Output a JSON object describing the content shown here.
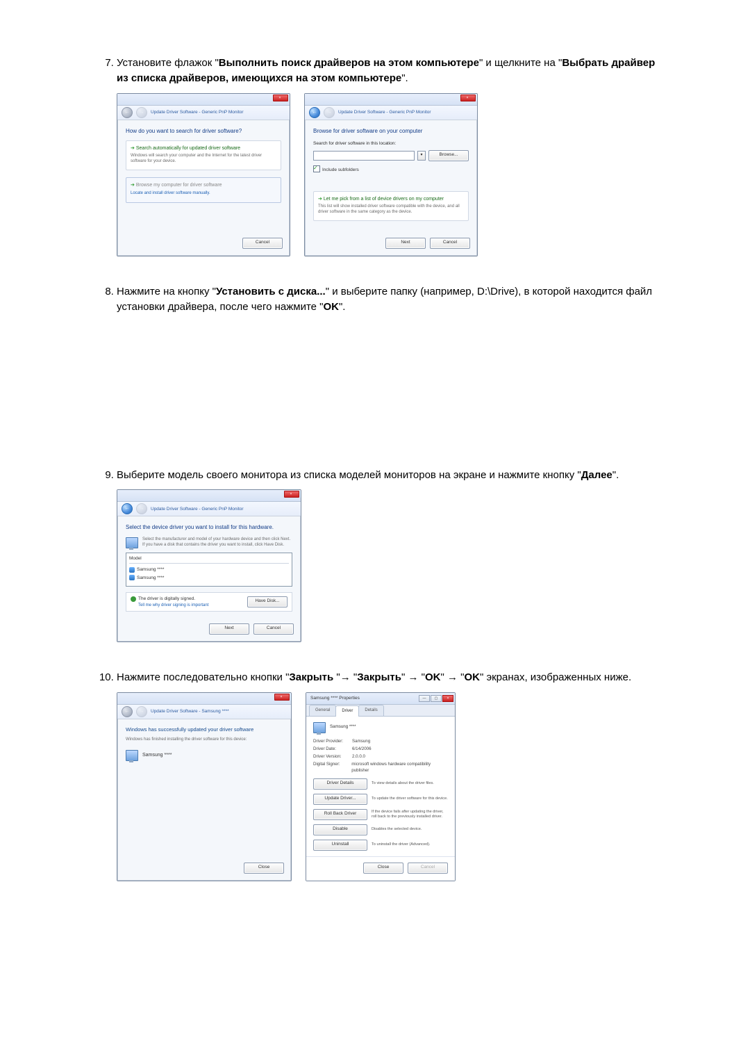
{
  "steps": {
    "s7": {
      "text_pre": "Установите флажок \"",
      "bold1": "Выполнить поиск драйверов на этом компьютере",
      "text_mid": "\" и щелкните на \"",
      "bold2": "Выбрать драйвер из списка драйверов, имеющихся на этом компьютере",
      "text_post": "\".",
      "dlg1": {
        "crumb": "Update Driver Software - Generic PnP Monitor",
        "heading": "How do you want to search for driver software?",
        "opt1_title": "Search automatically for updated driver software",
        "opt1_sub": "Windows will search your computer and the Internet for the latest driver software for your device.",
        "opt2_title": "Browse my computer for driver software",
        "opt2_sub": "Locate and install driver software manually.",
        "cancel": "Cancel"
      },
      "dlg2": {
        "crumb": "Update Driver Software - Generic PnP Monitor",
        "heading": "Browse for driver software on your computer",
        "label": "Search for driver software in this location:",
        "path_value": "",
        "browse": "Browse...",
        "include_sub": "Include subfolders",
        "opt_title": "Let me pick from a list of device drivers on my computer",
        "opt_sub": "This list will show installed driver software compatible with the device, and all driver software in the same category as the device.",
        "next": "Next",
        "cancel": "Cancel"
      }
    },
    "s8": {
      "t1": "Нажмите на кнопку \"",
      "b1": "Установить с диска...",
      "t2": "\" и выберите папку (например, D:\\Drive), в которой находится файл установки драйвера, после чего нажмите \"",
      "b2": "OK",
      "t3": "\"."
    },
    "s9": {
      "t1": "Выберите модель своего монитора из списка моделей мониторов на экране и нажмите кнопку \"",
      "b1": "Далее",
      "t2": "\".",
      "dlg": {
        "crumb": "Update Driver Software - Generic PnP Monitor",
        "heading": "Select the device driver you want to install for this hardware.",
        "sub": "Select the manufacturer and model of your hardware device and then click Next. If you have a disk that contains the driver you want to install, click Have Disk.",
        "model_col": "Model",
        "model1": "Samsung ****",
        "model2": "Samsung ****",
        "signed": "The driver is digitally signed.",
        "signed_link": "Tell me why driver signing is important",
        "have_disk": "Have Disk...",
        "next": "Next",
        "cancel": "Cancel"
      }
    },
    "s10": {
      "t1": "Нажмите последовательно кнопки \"",
      "b1": "Закрыть",
      "arrow": " \"→ \"",
      "b2": "Закрыть",
      "t2": "\" → \"",
      "b3": "OK",
      "t3": "\" → \"",
      "b4": "OK",
      "t4": "\" экранах, изображенных ниже.",
      "dlgA": {
        "crumb": "Update Driver Software - Samsung ****",
        "heading": "Windows has successfully updated your driver software",
        "sub": "Windows has finished installing the driver software for this device:",
        "device": "Samsung ****",
        "close": "Close"
      },
      "dlgB": {
        "title": "Samsung **** Properties",
        "tab_general": "General",
        "tab_driver": "Driver",
        "tab_details": "Details",
        "device": "Samsung ****",
        "k_provider": "Driver Provider:",
        "v_provider": "Samsung",
        "k_date": "Driver Date:",
        "v_date": "6/14/2006",
        "k_version": "Driver Version:",
        "v_version": "2.0.0.0",
        "k_signer": "Digital Signer:",
        "v_signer": "microsoft windows hardware compatibility publisher",
        "btn_details": "Driver Details",
        "btn_details_d": "To view details about the driver files.",
        "btn_update": "Update Driver...",
        "btn_update_d": "To update the driver software for this device.",
        "btn_rollback": "Roll Back Driver",
        "btn_rollback_d": "If the device fails after updating the driver, roll back to the previously installed driver.",
        "btn_disable": "Disable",
        "btn_disable_d": "Disables the selected device.",
        "btn_uninstall": "Uninstall",
        "btn_uninstall_d": "To uninstall the driver (Advanced).",
        "close": "Close",
        "cancel": "Cancel"
      }
    }
  }
}
